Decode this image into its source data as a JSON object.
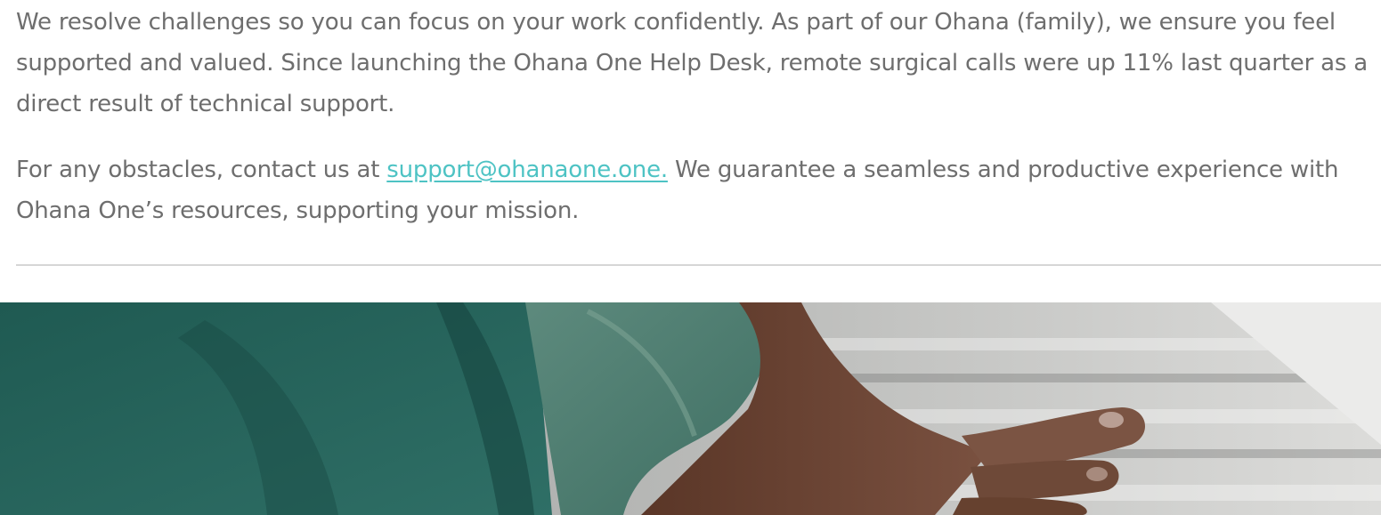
{
  "article": {
    "paragraph1": "We resolve challenges so you can focus on your work confidently. As part of our Ohana (family), we ensure you feel supported and valued. Since launching the Ohana One Help Desk, remote surgical calls were up 11% last quarter as a direct result of technical support.",
    "paragraph2_before": "For any obstacles, contact us at ",
    "support_email": "support@ohanaone.one.",
    "paragraph2_after": " We guarantee a seamless and productive experience with Ohana One’s resources, supporting your mission."
  },
  "colors": {
    "text": "#6e6e6e",
    "link": "#4ec3c4",
    "divider": "#d6d6d6",
    "scrubs": "#2f6b61",
    "skin": "#6b4332"
  }
}
